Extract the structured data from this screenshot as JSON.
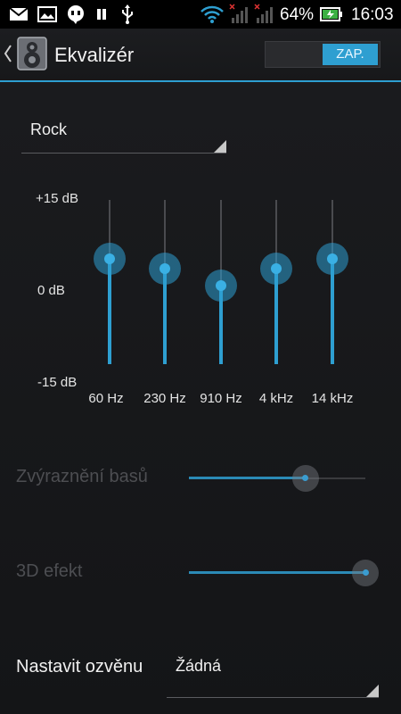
{
  "status_bar": {
    "battery_percent": "64%",
    "time": "16:03",
    "icons": [
      "gmail-icon",
      "gallery-icon",
      "chat-icon",
      "pause-icon",
      "usb-icon",
      "wifi-icon",
      "signal-icon",
      "signal-icon",
      "battery-charging-icon"
    ]
  },
  "action_bar": {
    "title": "Ekvalizér",
    "toggle_on_label": "ZAP."
  },
  "preset": {
    "selected": "Rock"
  },
  "equalizer": {
    "db_max_label": "+15 dB",
    "db_mid_label": "0 dB",
    "db_min_label": "-15 dB",
    "bands": [
      {
        "freq": "60 Hz",
        "level_db": 4.5
      },
      {
        "freq": "230 Hz",
        "level_db": 3.0
      },
      {
        "freq": "910 Hz",
        "level_db": 0.3
      },
      {
        "freq": "4 kHz",
        "level_db": 3.0
      },
      {
        "freq": "14 kHz",
        "level_db": 4.5
      }
    ]
  },
  "bass_boost": {
    "label": "Zvýraznění basů",
    "level": 0.66,
    "enabled": false
  },
  "virtualizer": {
    "label": "3D efekt",
    "level": 1.0,
    "enabled": false
  },
  "reverb": {
    "label": "Nastavit ozvěnu",
    "selected": "Žádná"
  },
  "colors": {
    "accent": "#2e9fd1",
    "background": "#17181b"
  }
}
